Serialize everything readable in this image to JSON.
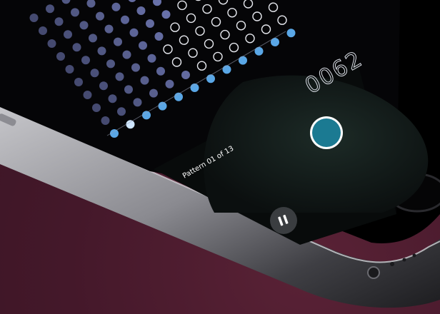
{
  "app": {
    "counter": "0062",
    "pattern_label": "Pattern 01 of 13",
    "pause_icon": "pause-icon",
    "target_icon": "target-dot-icon"
  },
  "colors": {
    "background": "#4a1b2c",
    "screen": "#050507",
    "circle_panel": "#1f2a26",
    "target_fill": "#1b7a92",
    "dot_purple": "#6f78b4",
    "dot_blue": "#5aa7e6",
    "dot_active": "#cfe6ff"
  }
}
